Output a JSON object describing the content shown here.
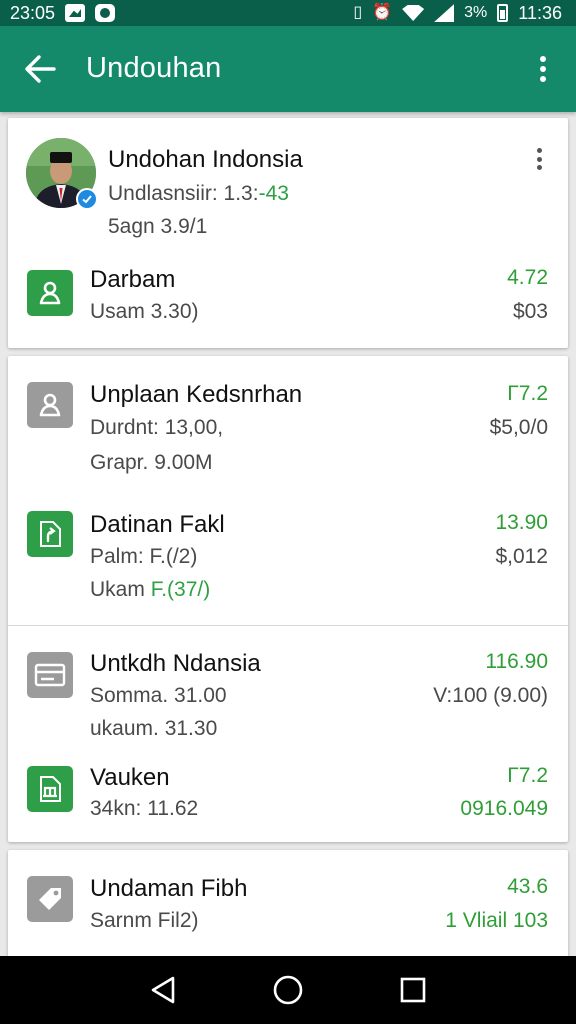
{
  "status_bar": {
    "time_left": "23:05",
    "battery_text": "3%",
    "time_right": "11:36"
  },
  "app_bar": {
    "title": "Undouhan"
  },
  "profile": {
    "name": "Undohan Indonsia",
    "line1_prefix": "Undlasnsiir: 1.3:",
    "line1_highlight": "-43",
    "line2": "5agn 3.9/1"
  },
  "rows": [
    {
      "title": "Darbam",
      "subtitle": "Usam 3.30)",
      "amount_top": "4.72",
      "amount_bottom": "$03",
      "icon": "person-icon"
    },
    {
      "title": "Unplaan Kedsnrhan",
      "subtitle": "Durdnt: 13,00,",
      "subtitle2": "Grapr. 9.00M",
      "amount_top": "Γ7.2",
      "amount_bottom": "$5,0/0",
      "icon": "person-outline-icon"
    },
    {
      "title": "Datinan Fakl",
      "subtitle": "Palm: F.(/2)",
      "subtitle2_prefix": "Ukam ",
      "subtitle2_highlight": "F.(37/)",
      "amount_top": "13.90",
      "amount_bottom": "$,012",
      "icon": "file-icon"
    },
    {
      "title": "Untkdh Ndansia",
      "subtitle": "Somma. 31.00",
      "subtitle2": "ukaum. 31.30",
      "amount_top": "116.90",
      "amount_bottom": "V:100 (9.00)",
      "icon": "card-icon"
    },
    {
      "title": "Vauken",
      "subtitle": "34kn: 11.62",
      "amount_top": "Γ7.2",
      "amount_bottom": "0916.049",
      "icon": "file-chart-icon"
    },
    {
      "title": "Undaman Fibh",
      "subtitle": "Sarnm Fil2)",
      "amount_top": "43.6",
      "amount_bottom": "1 Vliail 103",
      "icon": "tag-icon"
    }
  ],
  "colors": {
    "appbar": "#148a6a",
    "statusbar": "#0a5f4a",
    "accent_green": "#2f9e36",
    "icon_green": "#2e9e49",
    "icon_grey": "#9b9b9b"
  }
}
